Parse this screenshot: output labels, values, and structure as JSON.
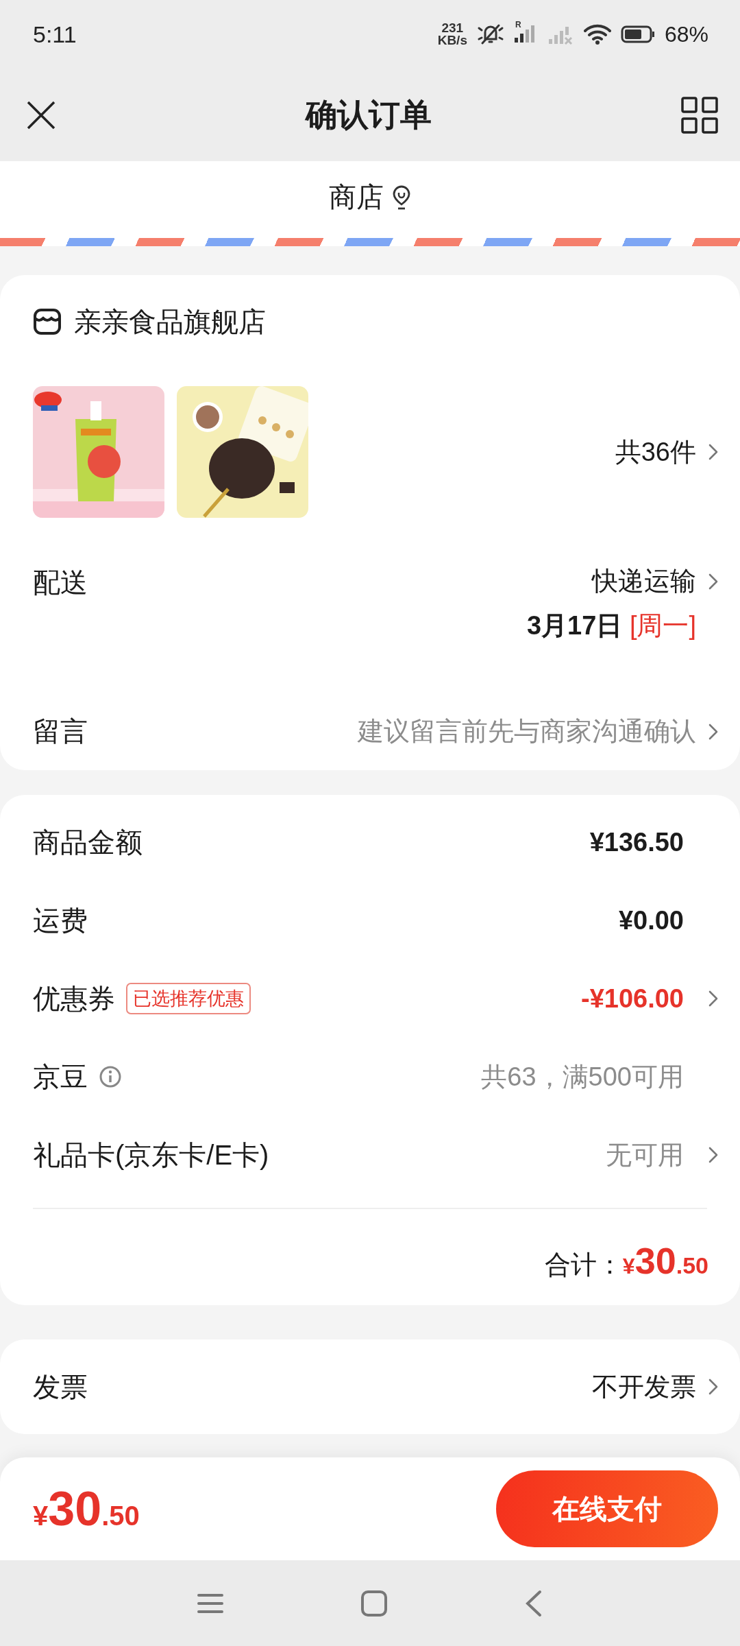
{
  "status_bar": {
    "time": "5:11",
    "speed_value": "231",
    "speed_unit": "KB/s",
    "roaming_mark": "R",
    "battery_percent": "68%"
  },
  "header": {
    "title": "确认订单"
  },
  "store_bar": {
    "label": "商店"
  },
  "shop": {
    "name": "亲亲食品旗舰店",
    "item_count": "共36件"
  },
  "delivery": {
    "label": "配送",
    "method": "快递运输",
    "date": "3月17日",
    "weekday": "[周一]"
  },
  "note": {
    "label": "留言",
    "hint": "建议留言前先与商家沟通确认"
  },
  "costs": [
    {
      "label": "商品金额",
      "kind": "amount",
      "value": "¥136.50",
      "arrow": false,
      "info": false
    },
    {
      "label": "运费",
      "kind": "amount",
      "value": "¥0.00",
      "arrow": false,
      "info": false
    },
    {
      "label": "优惠券",
      "kind": "discount",
      "tag": "已选推荐优惠",
      "value": "-¥106.00",
      "arrow": true,
      "info": false
    },
    {
      "label": "京豆",
      "kind": "muted",
      "value": "共63，满500可用",
      "arrow": false,
      "info": true
    },
    {
      "label": "礼品卡(京东卡/E卡)",
      "kind": "muted",
      "value": "无可用",
      "arrow": true,
      "info": false
    }
  ],
  "total": {
    "label": "合计：",
    "currency": "¥",
    "integer": "30",
    "decimal": ".50"
  },
  "invoice": {
    "label": "发票",
    "value": "不开发票"
  },
  "footer": {
    "currency": "¥",
    "integer": "30",
    "decimal": ".50",
    "pay_button": "在线支付"
  }
}
